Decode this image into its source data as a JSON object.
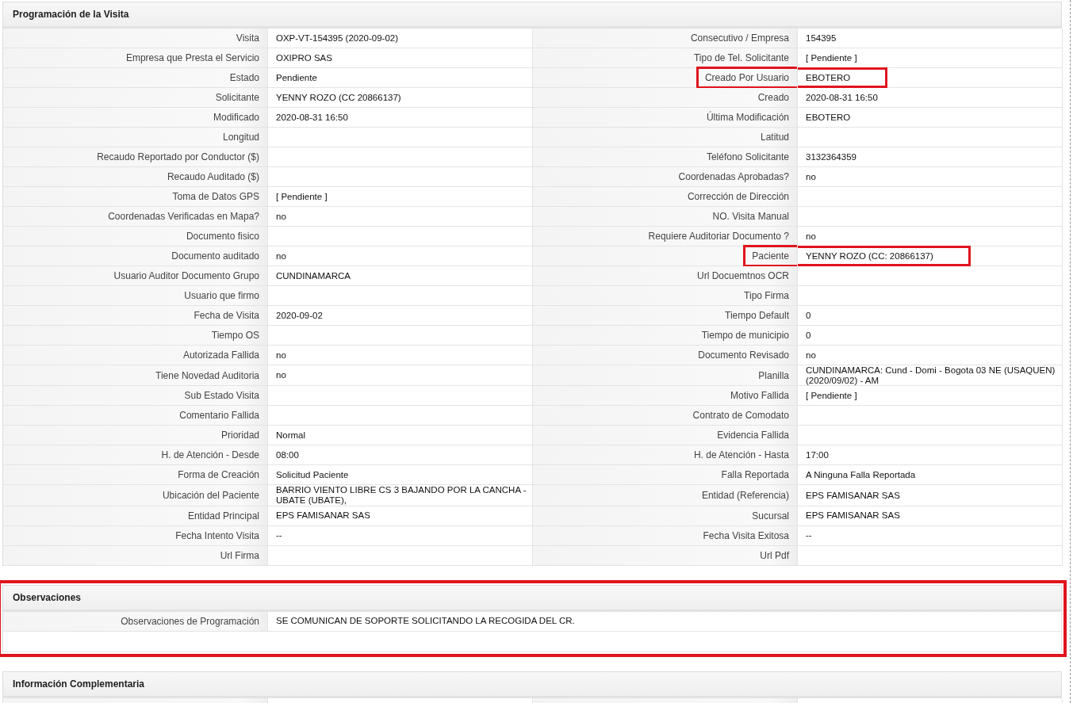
{
  "sections": [
    {
      "title": "Programación de la Visita",
      "highlighted": false,
      "kind": "pairs",
      "rows": [
        [
          {
            "label": "Visita",
            "value": "OXP-VT-154395 (2020-09-02)",
            "highlighted": false
          },
          {
            "label": "Consecutivo / Empresa",
            "value": "154395",
            "highlighted": false
          }
        ],
        [
          {
            "label": "Empresa que Presta el Servicio",
            "value": "OXIPRO SAS",
            "highlighted": false
          },
          {
            "label": "Tipo de Tel. Solicitante",
            "value": "[ Pendiente ]",
            "highlighted": false
          }
        ],
        [
          {
            "label": "Estado",
            "value": "Pendiente",
            "highlighted": false
          },
          {
            "label": "Creado Por Usuario",
            "value": "EBOTERO",
            "highlighted": true
          }
        ],
        [
          {
            "label": "Solicitante",
            "value": "YENNY ROZO (CC 20866137)",
            "highlighted": false
          },
          {
            "label": "Creado",
            "value": "2020-08-31 16:50",
            "highlighted": false
          }
        ],
        [
          {
            "label": "Modificado",
            "value": "2020-08-31 16:50",
            "highlighted": false
          },
          {
            "label": "Última Modificación",
            "value": "EBOTERO",
            "highlighted": false
          }
        ],
        [
          {
            "label": "Longitud",
            "highlighted": false
          },
          {
            "label": "Latitud",
            "highlighted": false
          }
        ],
        [
          {
            "label": "Recaudo Reportado por Conductor ($)",
            "highlighted": false
          },
          {
            "label": "Teléfono Solicitante",
            "value": "3132364359",
            "highlighted": false
          }
        ],
        [
          {
            "label": "Recaudo Auditado ($)",
            "highlighted": false
          },
          {
            "label": "Coordenadas Aprobadas?",
            "value": "no",
            "highlighted": false
          }
        ],
        [
          {
            "label": "Toma de Datos GPS",
            "value": "[ Pendiente ]",
            "highlighted": false
          },
          {
            "label": "Corrección de Dirección",
            "highlighted": false
          }
        ],
        [
          {
            "label": "Coordenadas Verificadas en Mapa?",
            "value": "no",
            "highlighted": false
          },
          {
            "label": "NO. Visita Manual",
            "highlighted": false
          }
        ],
        [
          {
            "label": "Documento fisico",
            "highlighted": false
          },
          {
            "label": "Requiere Auditoriar Documento ?",
            "value": "no",
            "highlighted": false
          }
        ],
        [
          {
            "label": "Documento auditado",
            "value": "no",
            "highlighted": false
          },
          {
            "label": "Paciente",
            "value": "YENNY ROZO (CC: 20866137)",
            "highlighted": true
          }
        ],
        [
          {
            "label": "Usuario Auditor Documento Grupo",
            "value": "CUNDINAMARCA",
            "highlighted": false
          },
          {
            "label": "Url Docuemtnos OCR",
            "highlighted": false
          }
        ],
        [
          {
            "label": "Usuario que firmo",
            "highlighted": false
          },
          {
            "label": "Tipo Firma",
            "highlighted": false
          }
        ],
        [
          {
            "label": "Fecha de Visita",
            "value": "2020-09-02",
            "highlighted": false
          },
          {
            "label": "Tiempo Default",
            "value": "0",
            "highlighted": false
          }
        ],
        [
          {
            "label": "Tiempo OS",
            "highlighted": false
          },
          {
            "label": "Tiempo de municipio",
            "value": "0",
            "highlighted": false
          }
        ],
        [
          {
            "label": "Autorizada Fallida",
            "value": "no",
            "highlighted": false
          },
          {
            "label": "Documento Revisado",
            "value": "no",
            "highlighted": false
          }
        ],
        [
          {
            "label": "Tiene Novedad Auditoria",
            "value": "no",
            "highlighted": false
          },
          {
            "label": "Planilla",
            "value": "CUNDINAMARCA: Cund - Domi - Bogota 03 NE (USAQUEN) (2020/09/02) - AM",
            "highlighted": false
          }
        ],
        [
          {
            "label": "Sub Estado Visita",
            "highlighted": false
          },
          {
            "label": "Motivo Fallida",
            "value": "[ Pendiente ]",
            "highlighted": false
          }
        ],
        [
          {
            "label": "Comentario Fallida",
            "highlighted": false
          },
          {
            "label": "Contrato de Comodato",
            "highlighted": false
          }
        ],
        [
          {
            "label": "Prioridad",
            "value": "Normal",
            "highlighted": false
          },
          {
            "label": "Evidencia Fallida",
            "highlighted": false
          }
        ],
        [
          {
            "label": "H. de Atención - Desde",
            "value": "08:00",
            "highlighted": false
          },
          {
            "label": "H. de Atención - Hasta",
            "value": "17:00",
            "highlighted": false
          }
        ],
        [
          {
            "label": "Forma de Creación",
            "value": "Solicitud Paciente",
            "highlighted": false
          },
          {
            "label": "Falla Reportada",
            "value": "A Ninguna Falla Reportada",
            "highlighted": false
          }
        ],
        [
          {
            "label": "Ubicación del Paciente",
            "value": "BARRIO VIENTO LIBRE CS 3 BAJANDO POR LA CANCHA - UBATE (UBATE),",
            "highlighted": false
          },
          {
            "label": "Entidad (Referencia)",
            "value": "EPS FAMISANAR SAS",
            "highlighted": false
          }
        ],
        [
          {
            "label": "Entidad Principal",
            "value": "EPS FAMISANAR SAS",
            "highlighted": false
          },
          {
            "label": "Sucursal",
            "value": "EPS FAMISANAR SAS",
            "highlighted": false
          }
        ],
        [
          {
            "label": "Fecha Intento Visita",
            "value": "--",
            "highlighted": false
          },
          {
            "label": "Fecha Visita Exitosa",
            "value": "--",
            "highlighted": false
          }
        ],
        [
          {
            "label": "Url Firma",
            "highlighted": false
          },
          {
            "label": "Url Pdf",
            "highlighted": false
          }
        ]
      ]
    },
    {
      "title": "Observaciones",
      "highlighted": true,
      "kind": "wide",
      "rows": [
        {
          "label": "Observaciones de Programación",
          "value": "SE COMUNICAN DE SOPORTE SOLICITANDO LA RECOGIDA DEL CR."
        }
      ]
    },
    {
      "title": "Información Complementaria",
      "highlighted": false,
      "kind": "cut"
    }
  ]
}
